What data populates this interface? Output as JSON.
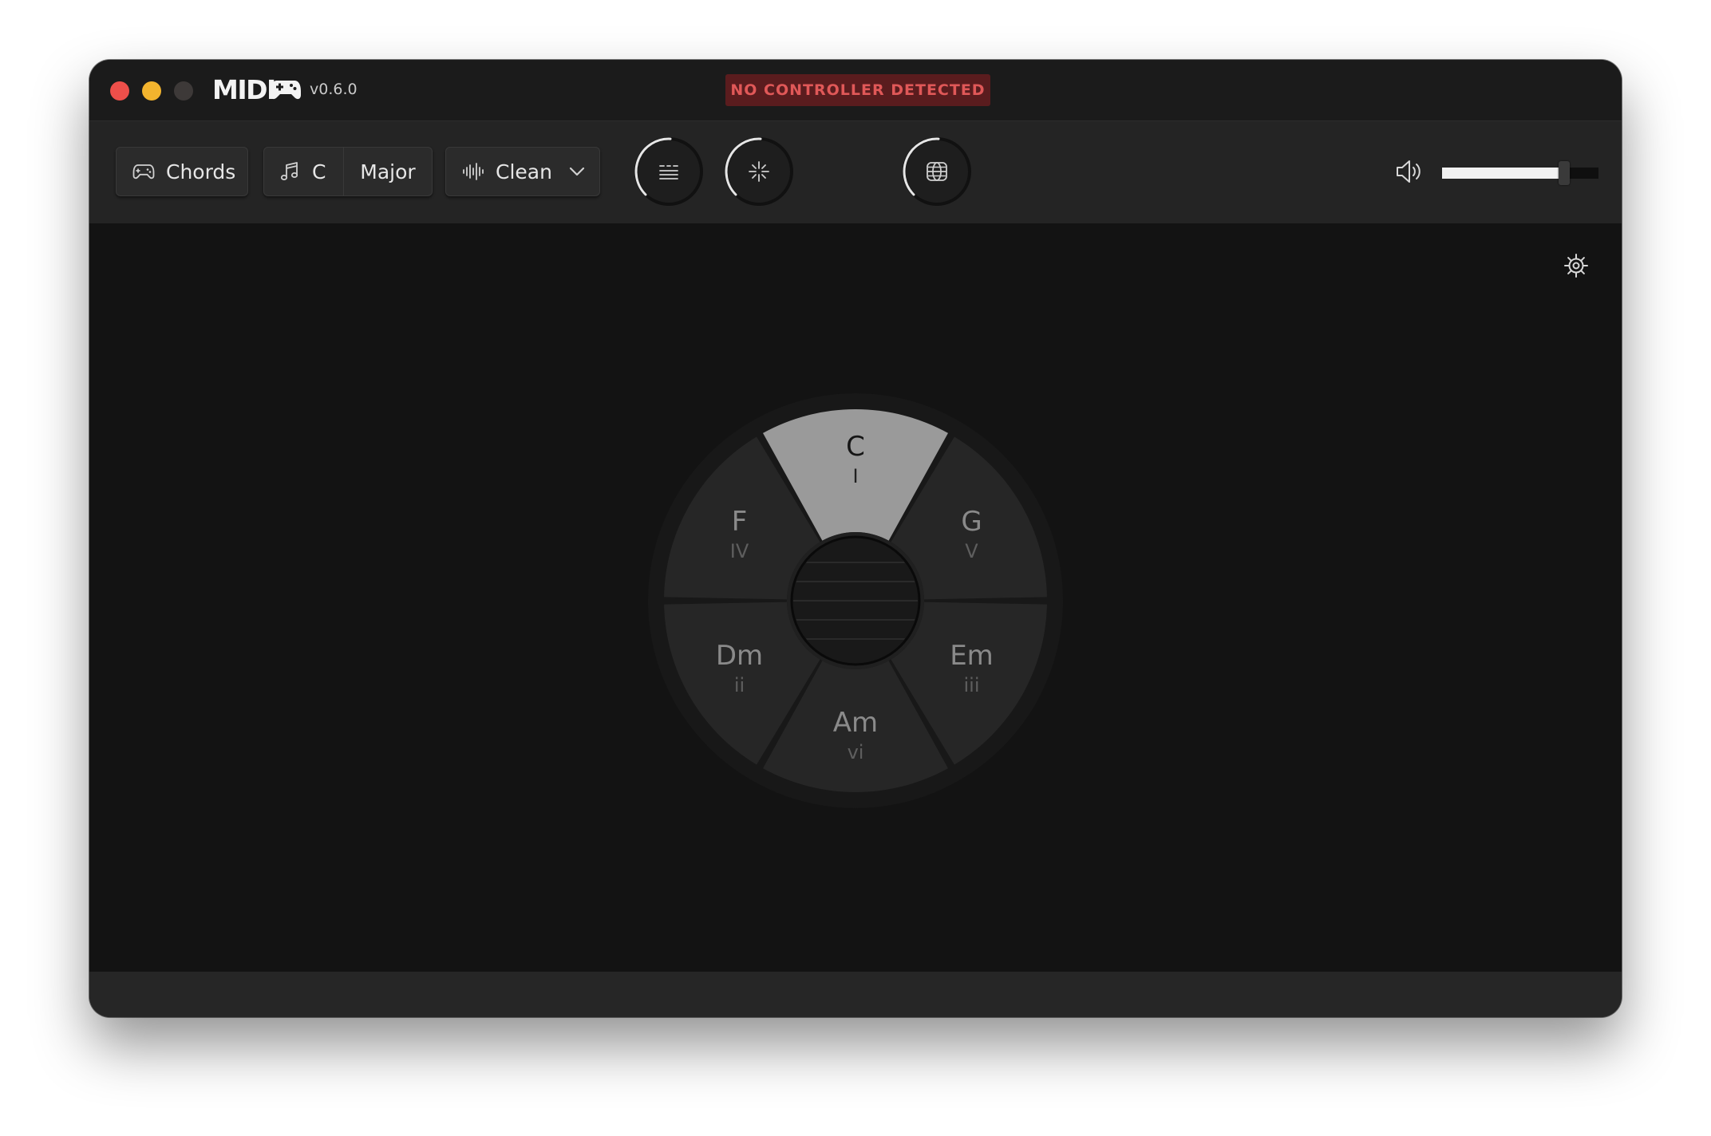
{
  "app": {
    "name": "MIDI",
    "version": "v0.6.0",
    "logo_icon": "gamepad-icon"
  },
  "window_controls": {
    "close_color": "#ee4f4a",
    "minimize_color": "#f3b42e",
    "maximize_color": "#3d3938"
  },
  "status": {
    "text": "NO CONTROLLER DETECTED",
    "color": "#e05858",
    "background": "#5a1c1e"
  },
  "toolbar": {
    "mode": {
      "label": "Chords",
      "icon": "gamepad-icon"
    },
    "key": {
      "note": "C",
      "mode": "Major",
      "icon": "music-note-icon"
    },
    "sound": {
      "label": "Clean",
      "icon": "waveform-icon",
      "dropdown_icon": "chevron-down-icon"
    },
    "knobs": [
      {
        "icon": "keys-grid-icon"
      },
      {
        "icon": "sparkle-icon"
      },
      {
        "icon": "globe-icon"
      }
    ],
    "volume": {
      "icon": "speaker-icon",
      "level": 0.78
    }
  },
  "settings": {
    "icon": "gear-icon"
  },
  "chord_wheel": {
    "active_index": 0,
    "active_color": "#9a9a9a",
    "center_icon": "grille-icon",
    "chords": [
      {
        "name": "C",
        "numeral": "I"
      },
      {
        "name": "G",
        "numeral": "V"
      },
      {
        "name": "Em",
        "numeral": "iii"
      },
      {
        "name": "Am",
        "numeral": "vi"
      },
      {
        "name": "Dm",
        "numeral": "ii"
      },
      {
        "name": "F",
        "numeral": "IV"
      }
    ]
  }
}
